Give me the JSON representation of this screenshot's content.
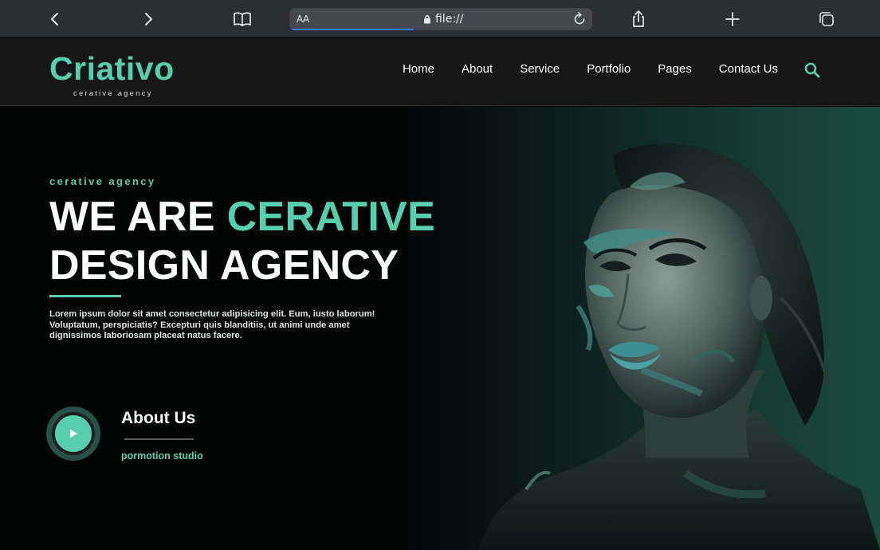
{
  "browser": {
    "text_size_label": "AA",
    "url": "file://",
    "load_progress": 0.41
  },
  "site": {
    "logo_title": "Criativo",
    "logo_tagline": "cerative agency",
    "nav": [
      "Home",
      "About",
      "Service",
      "Portfolio",
      "Pages",
      "Contact Us"
    ],
    "accent_color": "#57cfae"
  },
  "hero": {
    "eyebrow": "cerative agency",
    "title_part1": "WE ARE ",
    "title_accent": "CERATIVE",
    "title_line2": "DESIGN AGENCY",
    "description": "Lorem ipsum dolor sit amet consectetur adipisicing elit. Eum, iusto laborum! Voluptatum, perspiciatis? Excepturi quis blanditiis, ut animi unde amet dignissimos laboriosam placeat natus facere.",
    "about_title": "About Us",
    "about_subtitle": "pormotion studio"
  },
  "icons": {
    "back": "chevron-left-icon",
    "forward": "chevron-right-icon",
    "reader": "book-icon",
    "lock": "lock-icon",
    "reload": "reload-icon",
    "share": "share-icon",
    "new_tab": "plus-icon",
    "tabs": "tabs-icon",
    "search": "search-icon",
    "play": "play-icon"
  }
}
